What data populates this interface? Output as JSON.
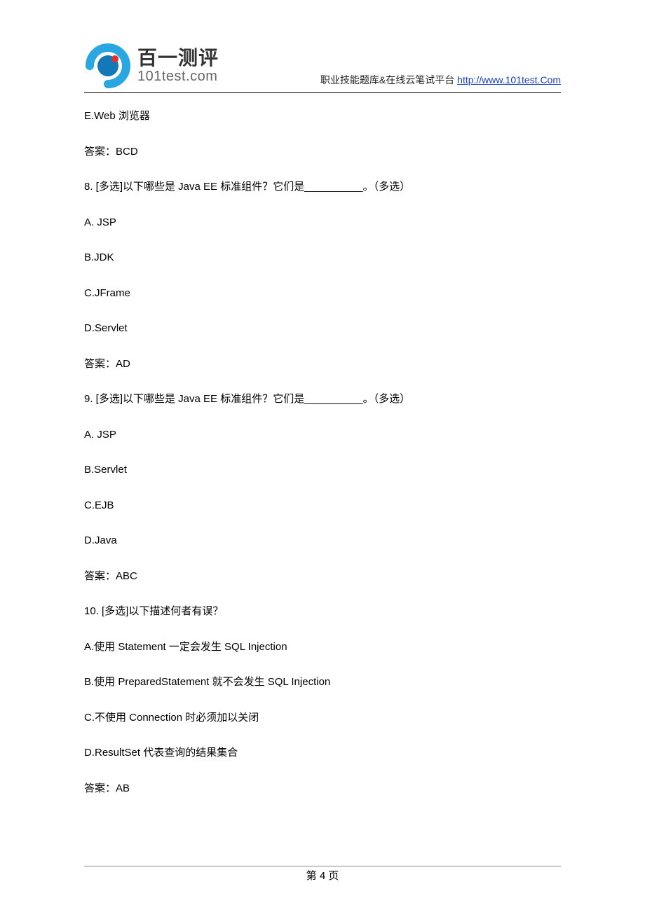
{
  "header": {
    "brand_cn": "百一测评",
    "brand_en": "101test.com",
    "desc": "职业技能题库&在线云笔试平台 ",
    "link_text": "http://www.101test.Com",
    "link_href": "http://www.101test.Com"
  },
  "content": {
    "lines": [
      "E.Web 浏览器",
      "答案：BCD",
      "8.    [多选]以下哪些是 Java EE 标准组件？它们是__________。（多选）",
      "A. JSP",
      "B.JDK",
      "C.JFrame",
      "D.Servlet",
      "答案：AD",
      "9.    [多选]以下哪些是 Java EE 标准组件？它们是__________。（多选）",
      "A. JSP",
      "B.Servlet",
      "C.EJB",
      "D.Java",
      "答案：ABC",
      "10.   [多选]以下描述何者有误？",
      "A.使用 Statement 一定会发生 SQL Injection",
      "B.使用 PreparedStatement 就不会发生 SQL Injection",
      "C.不使用 Connection 时必须加以关闭",
      "D.ResultSet 代表查询的结果集合",
      "答案：AB"
    ]
  },
  "footer": {
    "page_label": "第 4 页"
  }
}
